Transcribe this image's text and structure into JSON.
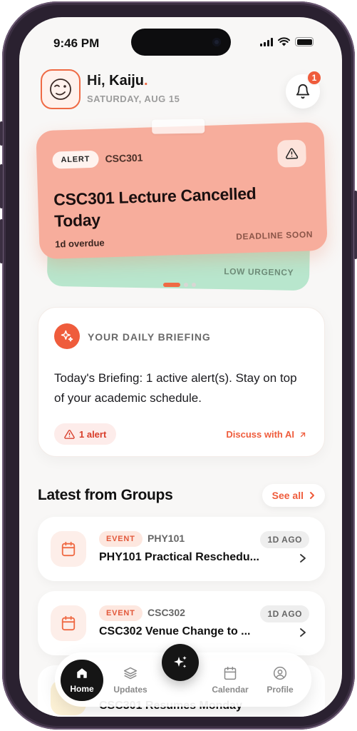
{
  "status_bar": {
    "time": "9:46 PM"
  },
  "header": {
    "greeting_prefix": "Hi, ",
    "name": "Kaiju",
    "name_suffix": ".",
    "date": "SATURDAY, AUG 15",
    "notification_count": "1"
  },
  "alert_card": {
    "tag": "ALERT",
    "course": "CSC301",
    "title": "CSC301 Lecture Cancelled Today",
    "overdue": "1d overdue",
    "deadline": "DEADLINE SOON"
  },
  "alert_card_back": {
    "urgency": "LOW URGENCY"
  },
  "carousel": {
    "count": 3,
    "active": 0
  },
  "briefing": {
    "heading": "YOUR DAILY BRIEFING",
    "text": "Today's Briefing: 1 active alert(s). Stay on top of your academic schedule.",
    "alert_count": "1 alert",
    "discuss_label": "Discuss with AI"
  },
  "groups": {
    "title": "Latest from Groups",
    "see_all": "See all",
    "items": [
      {
        "tag": "EVENT",
        "course": "PHY101",
        "ago": "1D AGO",
        "title": "PHY101 Practical Reschedu..."
      },
      {
        "tag": "EVENT",
        "course": "CSC302",
        "ago": "1D AGO",
        "title": "CSC302 Venue Change to ..."
      }
    ],
    "peek_title": "CSC301 Resumes Monday"
  },
  "nav": {
    "items": [
      {
        "label": "Home",
        "icon": "home-icon"
      },
      {
        "label": "Updates",
        "icon": "layers-icon"
      },
      {
        "label": "Calendar",
        "icon": "calendar-icon"
      },
      {
        "label": "Profile",
        "icon": "profile-icon"
      }
    ],
    "active": "Home",
    "fab_icon": "sparkles-icon"
  },
  "colors": {
    "accent": "#ef5c3c",
    "alert_card": "#f7ad9c",
    "back_card": "#b8e6cd"
  }
}
